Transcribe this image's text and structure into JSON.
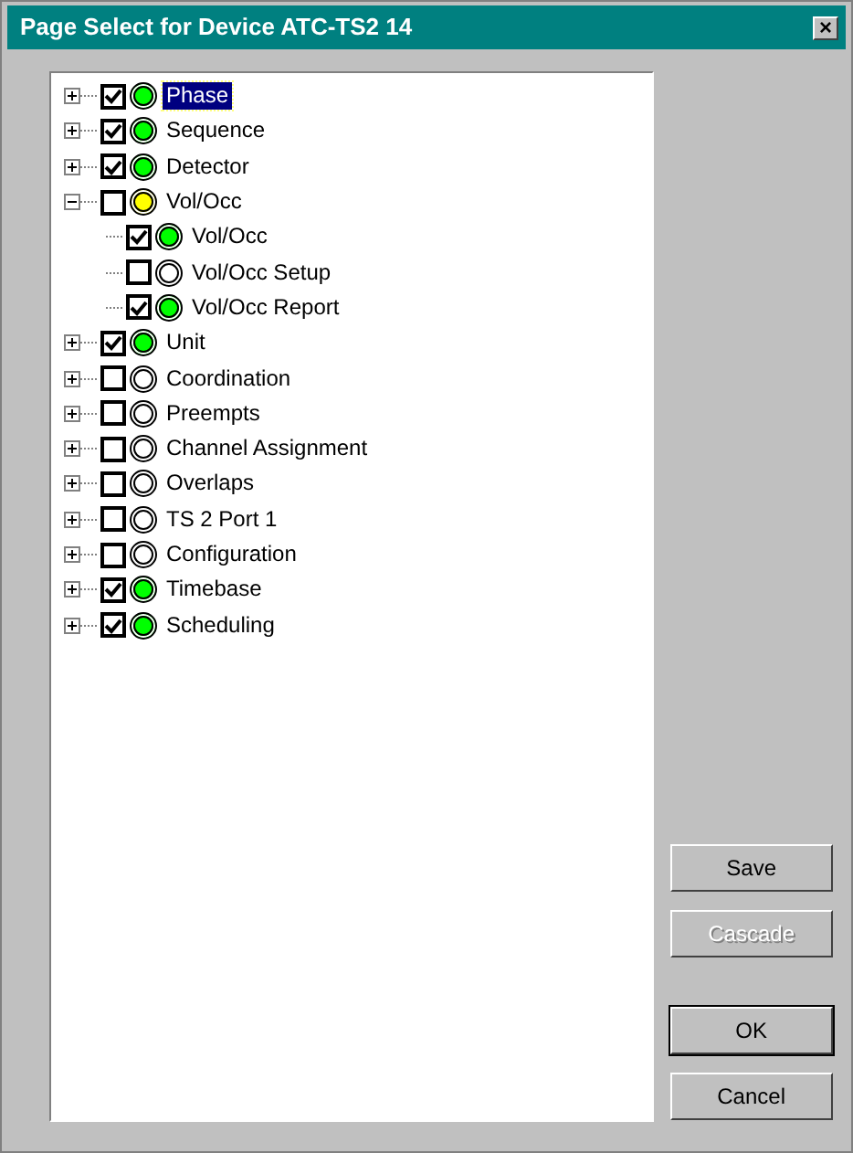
{
  "window": {
    "title": "Page Select for Device ATC-TS2 14",
    "close": "×"
  },
  "tree": {
    "items": [
      {
        "label": "Phase",
        "checked": true,
        "color": "#00ff00",
        "selected": true,
        "expanded": false
      },
      {
        "label": "Sequence",
        "checked": true,
        "color": "#00ff00",
        "selected": false,
        "expanded": false
      },
      {
        "label": "Detector",
        "checked": true,
        "color": "#00ff00",
        "selected": false,
        "expanded": false
      },
      {
        "label": "Vol/Occ",
        "checked": false,
        "color": "#ffff00",
        "selected": false,
        "expanded": true,
        "children": [
          {
            "label": "Vol/Occ",
            "checked": true,
            "color": "#00ff00",
            "selected": false
          },
          {
            "label": "Vol/Occ Setup",
            "checked": false,
            "color": "#ffffff",
            "selected": false
          },
          {
            "label": "Vol/Occ Report",
            "checked": true,
            "color": "#00ff00",
            "selected": false
          }
        ]
      },
      {
        "label": "Unit",
        "checked": true,
        "color": "#00ff00",
        "selected": false,
        "expanded": false
      },
      {
        "label": "Coordination",
        "checked": false,
        "color": "#ffffff",
        "selected": false,
        "expanded": false
      },
      {
        "label": "Preempts",
        "checked": false,
        "color": "#ffffff",
        "selected": false,
        "expanded": false
      },
      {
        "label": "Channel Assignment",
        "checked": false,
        "color": "#ffffff",
        "selected": false,
        "expanded": false
      },
      {
        "label": "Overlaps",
        "checked": false,
        "color": "#ffffff",
        "selected": false,
        "expanded": false
      },
      {
        "label": "TS 2 Port 1",
        "checked": false,
        "color": "#ffffff",
        "selected": false,
        "expanded": false
      },
      {
        "label": "Configuration",
        "checked": false,
        "color": "#ffffff",
        "selected": false,
        "expanded": false
      },
      {
        "label": "Timebase",
        "checked": true,
        "color": "#00ff00",
        "selected": false,
        "expanded": false
      },
      {
        "label": "Scheduling",
        "checked": true,
        "color": "#00ff00",
        "selected": false,
        "expanded": false
      }
    ]
  },
  "buttons": [
    {
      "label": "Save",
      "disabled": false,
      "default": false
    },
    {
      "label": "Cascade",
      "disabled": true,
      "default": false
    },
    {
      "label": "OK",
      "disabled": false,
      "default": true
    },
    {
      "label": "Cancel",
      "disabled": false,
      "default": false
    }
  ]
}
